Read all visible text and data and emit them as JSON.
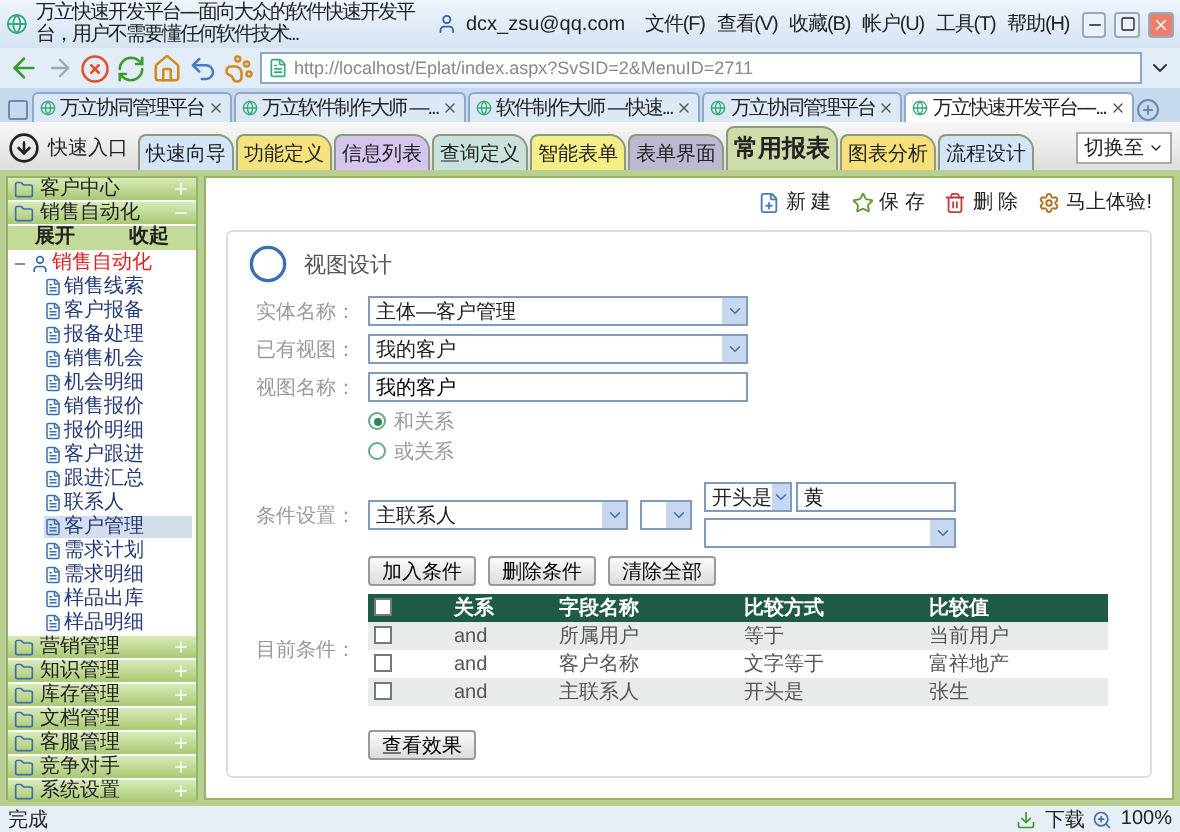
{
  "window": {
    "title": "万立快速开发平台----面向大众的软件快速开发平台，用户不需要懂任何软件技术...",
    "account": "dcx_zsu@qq.com",
    "menu": [
      "文件(F)",
      "查看(V)",
      "收藏(B)",
      "帐户(U)",
      "工具(T)",
      "帮助(H)"
    ]
  },
  "address_bar": {
    "url": "http://localhost/Eplat/index.aspx?SvSID=2&MenuID=2711"
  },
  "browser_tabs": [
    {
      "label": "万立协同管理平台",
      "selected": false
    },
    {
      "label": "万立软件制作大师 —...",
      "selected": false
    },
    {
      "label": "软件制作大师 —快速...",
      "selected": false
    },
    {
      "label": "万立协同管理平台",
      "selected": false
    },
    {
      "label": "万立快速开发平台----...",
      "selected": true
    }
  ],
  "app_tabs": {
    "quick_entry": "快速入口",
    "switch": "切换至",
    "tabs": [
      {
        "label": "快速向导",
        "selected": false,
        "color": "#d3e4f6"
      },
      {
        "label": "功能定义",
        "selected": false,
        "color": "#f6e27c"
      },
      {
        "label": "信息列表",
        "selected": false,
        "color": "#d4c4ee"
      },
      {
        "label": "查询定义",
        "selected": false,
        "color": "#c9e1dc"
      },
      {
        "label": "智能表单",
        "selected": false,
        "color": "#f5ee86"
      },
      {
        "label": "表单界面",
        "selected": false,
        "color": "#bcb8d2"
      },
      {
        "label": "常用报表",
        "selected": true,
        "color": "#cddca9"
      },
      {
        "label": "图表分析",
        "selected": false,
        "color": "#f7e079"
      },
      {
        "label": "流程设计",
        "selected": false,
        "color": "#d3e4f6"
      }
    ]
  },
  "sidebar": {
    "sections": [
      {
        "label": "客户中心",
        "expanded": false
      },
      {
        "label": "销售自动化",
        "expanded": true,
        "expand_all": "展开",
        "collapse_all": "收起",
        "tree": {
          "label": "销售自动化",
          "children": [
            {
              "label": "销售线索",
              "selected": false
            },
            {
              "label": "客户报备",
              "selected": false
            },
            {
              "label": "报备处理",
              "selected": false
            },
            {
              "label": "销售机会",
              "selected": false
            },
            {
              "label": "机会明细",
              "selected": false
            },
            {
              "label": "销售报价",
              "selected": false
            },
            {
              "label": "报价明细",
              "selected": false
            },
            {
              "label": "客户跟进",
              "selected": false
            },
            {
              "label": "跟进汇总",
              "selected": false
            },
            {
              "label": "联系人",
              "selected": false
            },
            {
              "label": "客户管理",
              "selected": true
            },
            {
              "label": "需求计划",
              "selected": false
            },
            {
              "label": "需求明细",
              "selected": false
            },
            {
              "label": "样品出库",
              "selected": false
            },
            {
              "label": "样品明细",
              "selected": false
            }
          ]
        }
      },
      {
        "label": "营销管理",
        "expanded": false
      },
      {
        "label": "知识管理",
        "expanded": false
      },
      {
        "label": "库存管理",
        "expanded": false
      },
      {
        "label": "文档管理",
        "expanded": false
      },
      {
        "label": "客服管理",
        "expanded": false
      },
      {
        "label": "竞争对手",
        "expanded": false
      },
      {
        "label": "系统设置",
        "expanded": false
      }
    ]
  },
  "toolbar": [
    {
      "label": "新 建",
      "kind": "new"
    },
    {
      "label": "保 存",
      "kind": "save"
    },
    {
      "label": "删 除",
      "kind": "delete"
    },
    {
      "label": "马上体验!",
      "kind": "try"
    }
  ],
  "form": {
    "legend": "视图设计",
    "fields": [
      {
        "label": "实体名称：",
        "kind": "select",
        "value": "主体—客户管理"
      },
      {
        "label": "已有视图：",
        "kind": "select",
        "value": "我的客户"
      },
      {
        "label": "视图名称：",
        "kind": "input",
        "value": "我的客户"
      }
    ],
    "relations": [
      {
        "label": "和关系",
        "selected": true
      },
      {
        "label": "或关系",
        "selected": false
      }
    ],
    "condition": {
      "label": "条件设置：",
      "field": "主联系人",
      "operator": "开头是",
      "value": "黄"
    },
    "condition_buttons": [
      "加入条件",
      "删除条件",
      "清除全部"
    ],
    "current": {
      "label": "目前条件：",
      "header_checked": false,
      "columns": [
        "关系",
        "字段名称",
        "比较方式",
        "比较值"
      ],
      "rows": [
        {
          "checked": false,
          "cells": [
            "and",
            "所属用户",
            "等于",
            "当前用户"
          ]
        },
        {
          "checked": false,
          "cells": [
            "and",
            "客户名称",
            "文字等于",
            "富祥地产"
          ]
        },
        {
          "checked": false,
          "cells": [
            "and",
            "主联系人",
            "开头是",
            "张生"
          ]
        }
      ]
    },
    "preview_button": "查看效果"
  },
  "status_bar": {
    "text": "完成",
    "downloads": "下载",
    "zoom": "100%"
  }
}
